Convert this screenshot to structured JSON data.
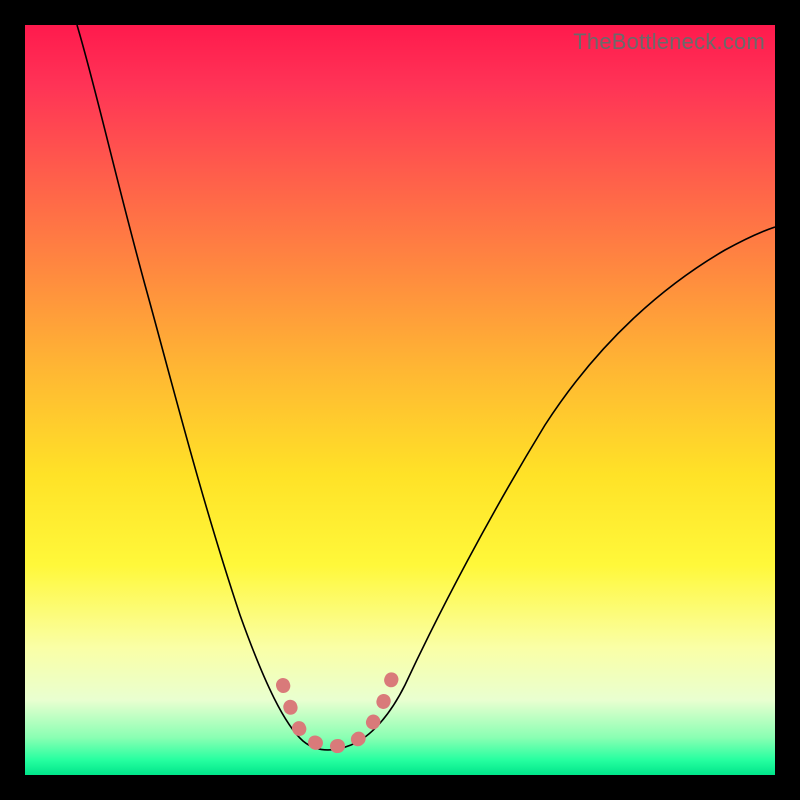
{
  "watermark": "TheBottleneck.com",
  "chart_data": {
    "type": "line",
    "title": "",
    "xlabel": "",
    "ylabel": "",
    "xlim": [
      0,
      100
    ],
    "ylim": [
      0,
      100
    ],
    "series": [
      {
        "name": "bottleneck-curve",
        "x": [
          7,
          10,
          15,
          20,
          25,
          30,
          34,
          36,
          38,
          40,
          44,
          48,
          54,
          60,
          68,
          76,
          84,
          92,
          99
        ],
        "values": [
          100,
          85,
          67,
          50,
          35,
          21,
          11,
          7,
          5,
          5,
          5,
          6,
          10,
          18,
          30,
          43,
          55,
          65,
          72
        ]
      }
    ],
    "annotations": {
      "dotted_region_x": [
        34,
        48
      ],
      "dotted_path": "L-shape dotted marker at curve minimum"
    },
    "background_gradient": {
      "top": "#ff1a4d",
      "mid": "#ffe227",
      "bottom": "#00e58a"
    }
  }
}
